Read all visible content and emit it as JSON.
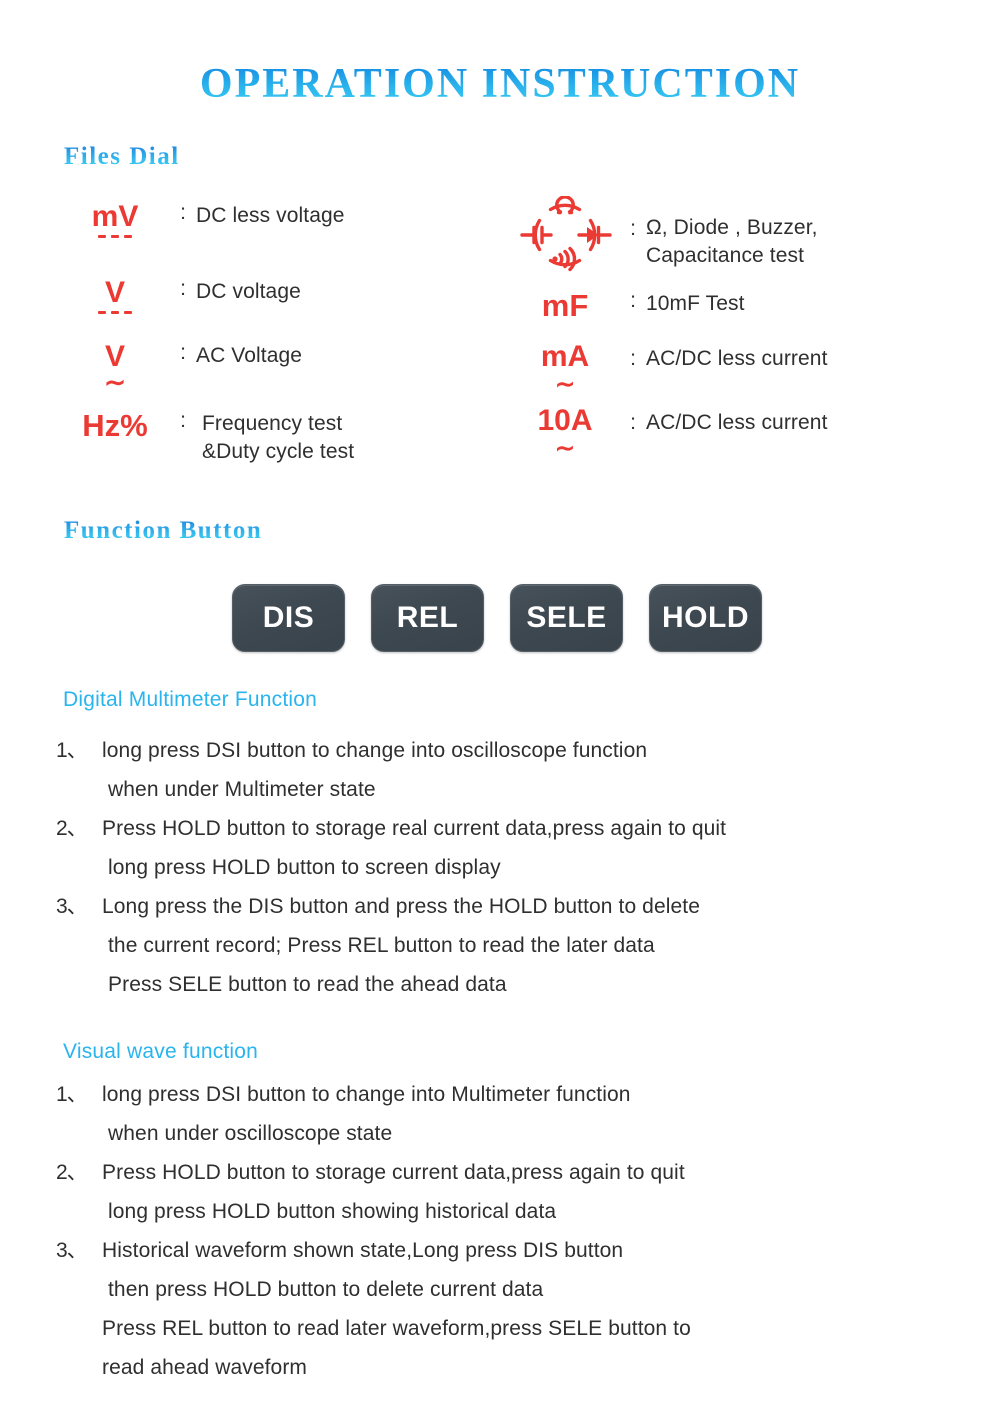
{
  "title": "OPERATION  INSTRUCTION",
  "sections": {
    "files_dial_heading": "Files  Dial",
    "function_button_heading": "Function  Button",
    "digital_multimeter_heading": "Digital Multimeter Function",
    "visual_wave_heading": "Visual wave function"
  },
  "colors": {
    "heading_blue": "#2ab3ec",
    "symbol_red": "#ea3a33",
    "body_text": "#2f2f2f",
    "button_face": "#3d4850",
    "button_label": "#ffffff"
  },
  "dial": {
    "separator": ":",
    "left_column": [
      {
        "symbol": "mV",
        "marker": "dc",
        "description": "DC less voltage"
      },
      {
        "symbol": "V",
        "marker": "dc",
        "description": "DC voltage"
      },
      {
        "symbol": "V",
        "marker": "ac",
        "description": "AC Voltage"
      },
      {
        "symbol": "Hz%",
        "marker": "none",
        "description": "Frequency test\n&Duty cycle test"
      }
    ],
    "right_column": [
      {
        "symbol": "ohm-dial-icon",
        "marker": "none",
        "description": "Ω, Diode , Buzzer,\nCapacitance test"
      },
      {
        "symbol": "mF",
        "marker": "none",
        "description": "10mF Test"
      },
      {
        "symbol": "mA",
        "marker": "acdc",
        "description": "AC/DC less current"
      },
      {
        "symbol": "10A",
        "marker": "acdc",
        "description": "AC/DC less current"
      }
    ]
  },
  "function_buttons": [
    {
      "label": "DIS"
    },
    {
      "label": "REL"
    },
    {
      "label": "SELE"
    },
    {
      "label": "HOLD"
    }
  ],
  "digital_multimeter_function": [
    {
      "num": "1、",
      "text": "long press DSI button to change into oscilloscope function"
    },
    {
      "num": "",
      "text": "when under Multimeter state"
    },
    {
      "num": "2、",
      "text": "Press HOLD button to storage real current data,press again to quit"
    },
    {
      "num": "",
      "text": "long press HOLD button to screen display"
    },
    {
      "num": "3、",
      "text": "Long press the DIS button and press the HOLD button to delete"
    },
    {
      "num": "",
      "text": "the current record; Press REL button to read the later data"
    },
    {
      "num": "",
      "text": "Press SELE button to read the ahead data"
    }
  ],
  "visual_wave_function": [
    {
      "num": "1、",
      "text": "long press DSI button to change into Multimeter function"
    },
    {
      "num": "",
      "text": "when under oscilloscope state"
    },
    {
      "num": "2、",
      "text": "Press HOLD button to storage current data,press again to quit"
    },
    {
      "num": "",
      "text": "long press HOLD button showing historical data"
    },
    {
      "num": "3、",
      "text": "Historical waveform shown state,Long press DIS button"
    },
    {
      "num": "",
      "text": "then press HOLD button to delete current data"
    },
    {
      "num": "",
      "text": "Press REL button to read later waveform,press SELE button to"
    },
    {
      "num": "",
      "text": "read ahead waveform"
    }
  ]
}
